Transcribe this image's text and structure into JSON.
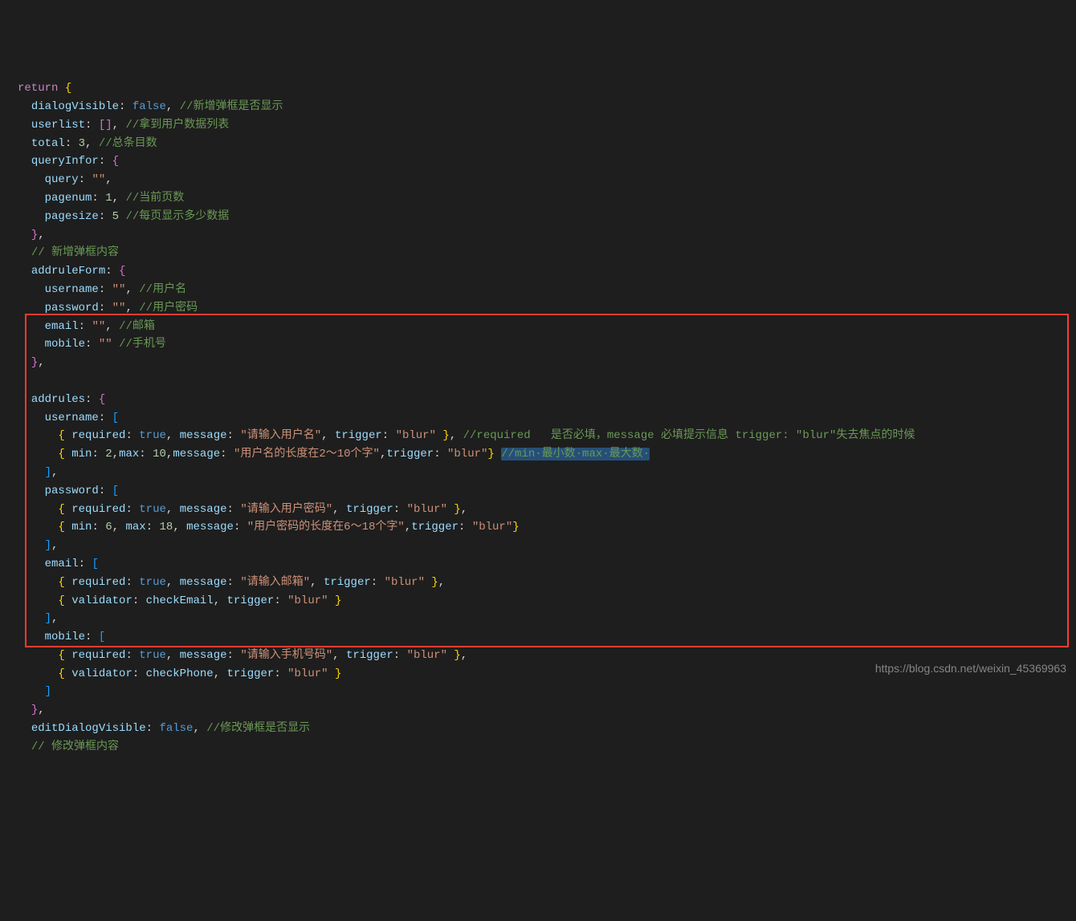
{
  "watermark": "https://blog.csdn.net/weixin_45369963",
  "code": {
    "return": "return",
    "dialogVisible": "dialogVisible",
    "false": "false",
    "true": "true",
    "userlist": "userlist",
    "total": "total",
    "totalVal": "3",
    "queryInfor": "queryInfor",
    "query": "query",
    "pagenum": "pagenum",
    "pagenumVal": "1",
    "pagesize": "pagesize",
    "pagesizeVal": "5",
    "addruleForm": "addruleForm",
    "username": "username",
    "password": "password",
    "email": "email",
    "mobile": "mobile",
    "addrules": "addrules",
    "required": "required",
    "message": "message",
    "trigger": "trigger",
    "min": "min",
    "max": "max",
    "validator": "validator",
    "checkEmail": "checkEmail",
    "checkPhone": "checkPhone",
    "editDialogVisible": "editDialogVisible",
    "emptyStr": "\"\"",
    "blurStr": "\"blur\"",
    "msgUsername": "\"请输入用户名\"",
    "msgUsernameLen": "\"用户名的长度在2～10个字\"",
    "msgPassword": "\"请输入用户密码\"",
    "msgPasswordLen": "\"用户密码的长度在6～18个字\"",
    "msgEmail": "\"请输入邮箱\"",
    "msgMobile": "\"请输入手机号码\"",
    "n2": "2",
    "n10": "10",
    "n6": "6",
    "n18": "18"
  },
  "comments": {
    "dialogVisible": "//新增弹框是否显示",
    "userlist": "//拿到用户数据列表",
    "total": "//总条目数",
    "pagenum": "//当前页数",
    "pagesize": "//每页显示多少数据",
    "addruleFormTitle": "// 新增弹框内容",
    "username": "//用户名",
    "password": "//用户密码",
    "email": "//邮箱",
    "mobile": "//手机号",
    "requiredLine": "//required   是否必填，message 必填提示信息 trigger: \"blur\"失去焦点的时候",
    "minmax": "//min·最小数·max·最大数·",
    "editDialogVisible": "//修改弹框是否显示",
    "editFormTitle": "// 修改弹框内容"
  }
}
